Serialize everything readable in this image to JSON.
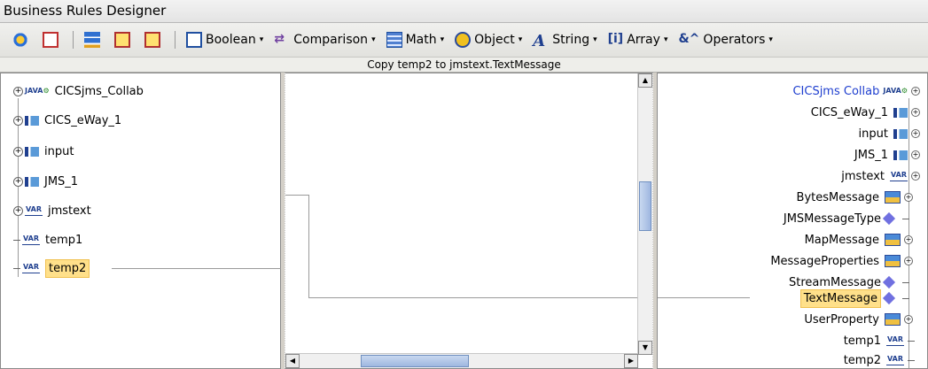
{
  "window": {
    "title": "Business Rules Designer"
  },
  "toolbar": {
    "menus": [
      {
        "label": "Boolean",
        "icon": "boolean-icon"
      },
      {
        "label": "Comparison",
        "icon": "comparison-icon"
      },
      {
        "label": "Math",
        "icon": "math-icon"
      },
      {
        "label": "Object",
        "icon": "object-icon"
      },
      {
        "label": "String",
        "icon": "string-icon"
      },
      {
        "label": "Array",
        "icon": "array-icon"
      },
      {
        "label": "Operators",
        "icon": "operators-icon"
      }
    ],
    "icon_glyphs": {
      "comparison": "⇄",
      "string": "A",
      "array": "[i]",
      "operators": "&^",
      "caret": "▾"
    }
  },
  "status": {
    "rule": "Copy temp2 to jmstext.TextMessage"
  },
  "left_tree": {
    "items": [
      {
        "label": "CICSjms_Collab",
        "type": "collab"
      },
      {
        "label": "CICS_eWay_1",
        "type": "eway"
      },
      {
        "label": "input",
        "type": "eway"
      },
      {
        "label": "JMS_1",
        "type": "eway"
      },
      {
        "label": "jmstext",
        "type": "var"
      },
      {
        "label": "temp1",
        "type": "var"
      },
      {
        "label": "temp2",
        "type": "var",
        "selected": true
      }
    ],
    "var_tag": "VAR",
    "collab_tag": "JAVA",
    "expander": "+"
  },
  "right_tree": {
    "items": [
      {
        "label": "CICSjms Collab",
        "type": "collab",
        "color": "#1f3fcf"
      },
      {
        "label": "CICS_eWay_1",
        "type": "eway"
      },
      {
        "label": "input",
        "type": "eway"
      },
      {
        "label": "JMS_1",
        "type": "eway"
      },
      {
        "label": "jmstext",
        "type": "var"
      },
      {
        "label": "BytesMessage",
        "type": "bundle"
      },
      {
        "label": "JMSMessageType",
        "type": "diamond"
      },
      {
        "label": "MapMessage",
        "type": "bundle"
      },
      {
        "label": "MessageProperties",
        "type": "bundle"
      },
      {
        "label": "StreamMessage",
        "type": "diamond"
      },
      {
        "label": "TextMessage",
        "type": "diamond",
        "selected": true
      },
      {
        "label": "UserProperty",
        "type": "bundle"
      },
      {
        "label": "temp1",
        "type": "var"
      },
      {
        "label": "temp2",
        "type": "var"
      }
    ]
  },
  "scroll": {
    "up": "▲",
    "down": "▼",
    "left": "◀",
    "right": "▶"
  },
  "colors": {
    "highlight": "#ffe08a",
    "link": "#9a9a9a",
    "accent": "#1f3fcf"
  }
}
